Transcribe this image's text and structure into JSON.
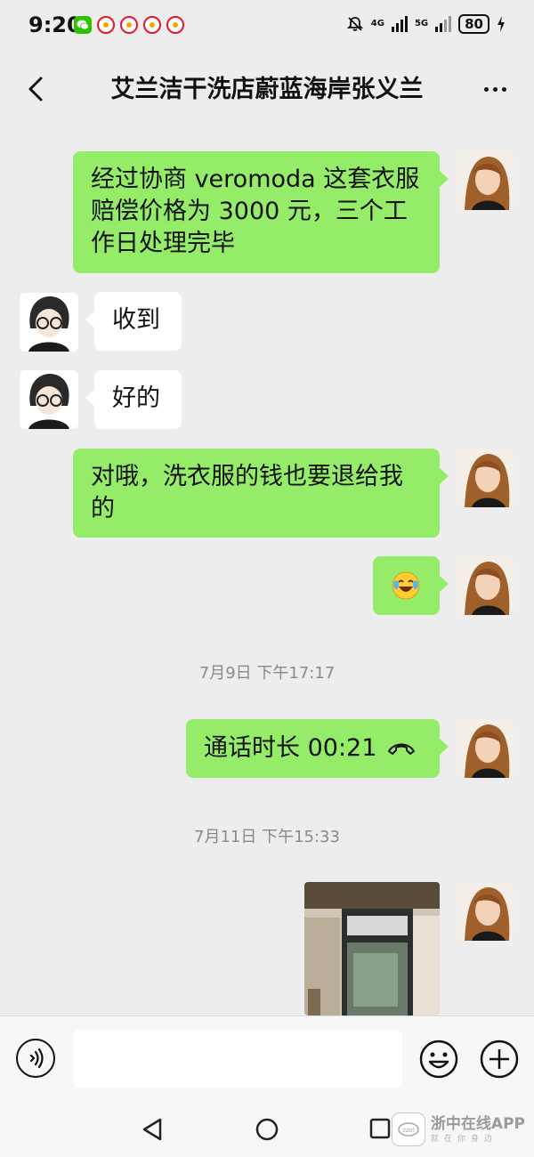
{
  "status_bar": {
    "time": "9:20",
    "network_a": "4G",
    "network_b": "5G",
    "battery": "80"
  },
  "header": {
    "title": "艾兰洁干洗店蔚蓝海岸张义兰"
  },
  "messages": [
    {
      "sender": "me",
      "text": "经过协商 veromoda 这套衣服赔偿价格为 3000 元，三个工作日处理完毕"
    },
    {
      "sender": "other",
      "text": "收到"
    },
    {
      "sender": "other",
      "text": "好的"
    },
    {
      "sender": "me",
      "text": "对哦，洗衣服的钱也要退给我的"
    },
    {
      "sender": "me",
      "emoji": "laughing-tears-emoji"
    },
    {
      "timestamp": "7月9日 下午17:17"
    },
    {
      "sender": "me",
      "call_text": "通话时长 00:21"
    },
    {
      "timestamp": "7月11日 下午15:33"
    },
    {
      "sender": "me",
      "image": "photo-message"
    }
  ],
  "input": {
    "placeholder": ""
  },
  "watermark": {
    "brand": "浙中在线APP",
    "sub": "就在你身边"
  },
  "colors": {
    "my_bubble": "#95ec69",
    "other_bubble": "#ffffff",
    "background": "#ededed"
  }
}
